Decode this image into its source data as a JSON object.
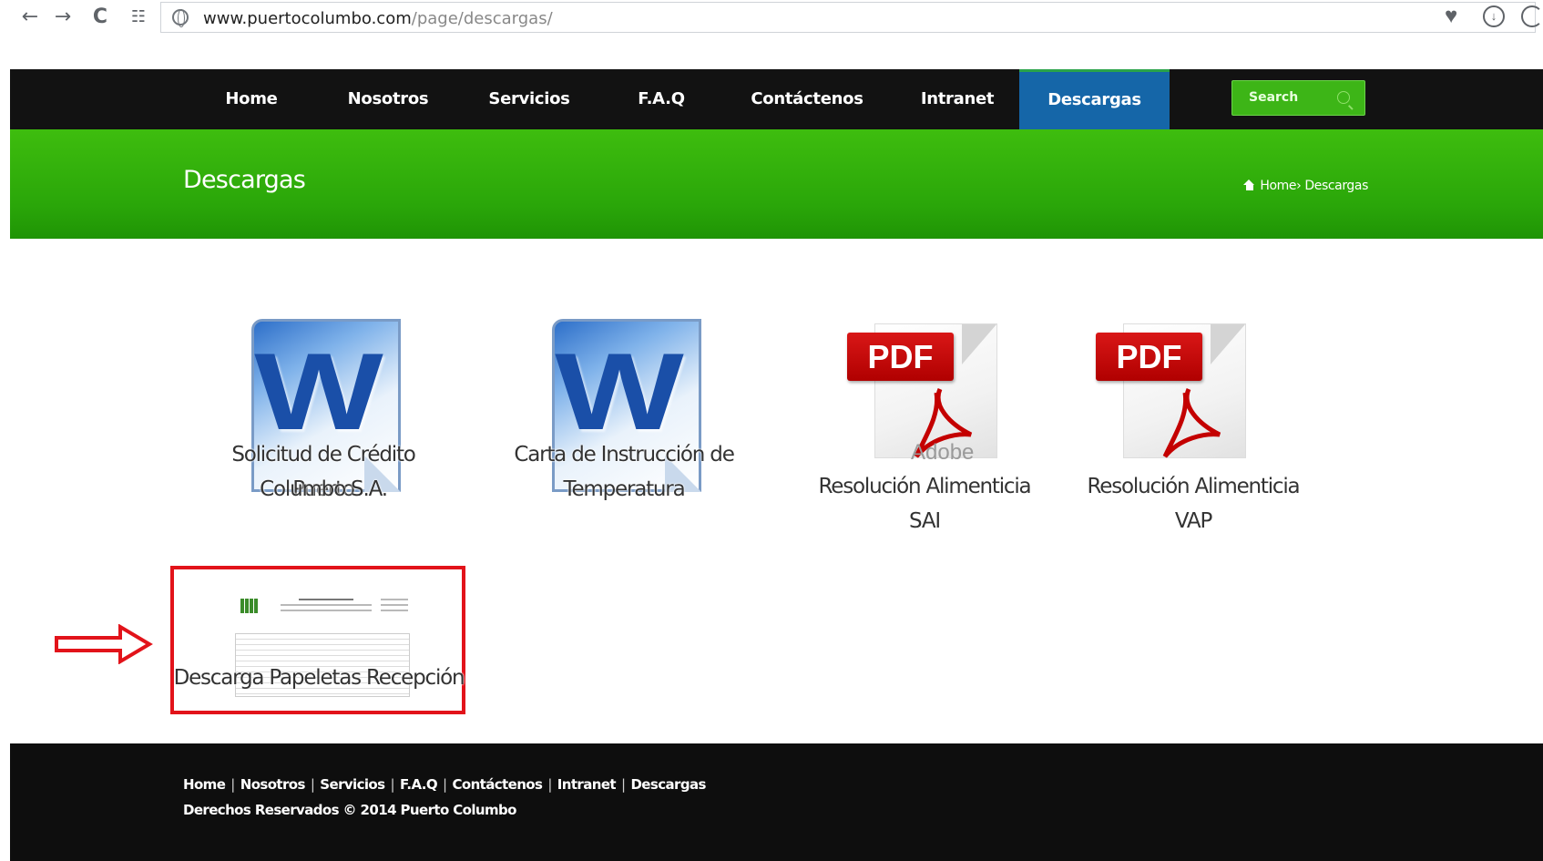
{
  "browser": {
    "url_host": "www.puertocolumbo.com",
    "url_path": "/page/descargas/",
    "back_icon": "←",
    "forward_icon": "→",
    "reload_icon": "C",
    "apps_icon": "☷",
    "heart_icon": "♥",
    "download_icon": "↓"
  },
  "nav": {
    "items": [
      "Home",
      "Nosotros",
      "Servicios",
      "F.A.Q",
      "Contáctenos",
      "Intranet",
      "Descargas"
    ],
    "active": "Descargas",
    "search_placeholder": "Search"
  },
  "banner": {
    "title": "Descargas",
    "breadcrumb_home": "Home",
    "breadcrumb_sep": "›",
    "breadcrumb_current": "Descargas"
  },
  "downloads": [
    {
      "label_line1": "Solicitud de Crédito Puerto",
      "label_line2": "Columbo S.A.",
      "icon": "word-document-icon"
    },
    {
      "label_line1": "Carta de Instrucción de",
      "label_line2": "Temperatura",
      "icon": "word-document-icon"
    },
    {
      "label": "Resolución Alimenticia SAI",
      "icon": "pdf-document-icon",
      "badge": "PDF",
      "watermark": "Adobe"
    },
    {
      "label": "Resolución Alimenticia VAP",
      "icon": "pdf-document-icon",
      "badge": "PDF"
    },
    {
      "label": "Descarga Papeletas Recepción",
      "icon": "receipt-form-thumbnail"
    }
  ],
  "word_letter": "W",
  "highlight_color": "#e2131a",
  "footer": {
    "links": [
      "Home",
      "Nosotros",
      "Servicios",
      "F.A.Q",
      "Contáctenos",
      "Intranet",
      "Descargas"
    ],
    "copyright": "Derechos Reservados © 2014 Puerto Columbo"
  },
  "colors": {
    "nav_bg": "#121212",
    "active_tab": "#1566a8",
    "banner_green": "#2aa609",
    "search_green": "#3db517",
    "footer_bg": "#0e0e0e"
  }
}
